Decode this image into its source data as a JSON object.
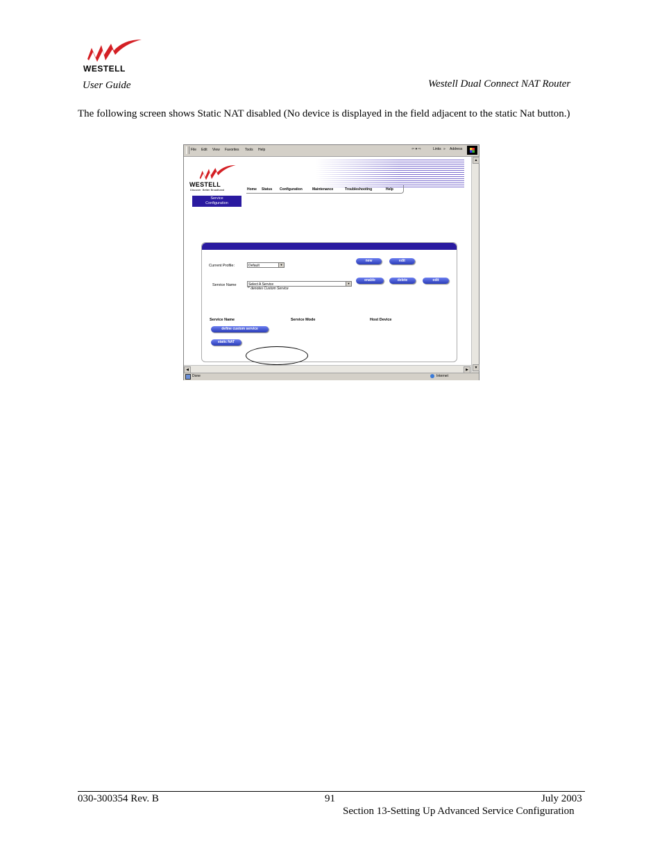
{
  "header": {
    "user_guide": "User Guide",
    "product": "Westell Dual Connect NAT Router",
    "logo_text": "WESTELL"
  },
  "intro_text": "The following screen shows Static NAT disabled (No device is displayed in the field adjacent to the static Nat button.)",
  "screenshot": {
    "menu": [
      "File",
      "Edit",
      "View",
      "Favorites",
      "Tools",
      "Help"
    ],
    "toolbar": {
      "back": "⇦ ▾ ⇨",
      "links": "Links",
      "links_more": "»",
      "address": "Address"
    },
    "logo_text": "WESTELL",
    "tagline": "Discover  Better Broadband",
    "nav": [
      "Home",
      "Status",
      "Configuration",
      "Maintenance",
      "Troubleshooting",
      "Help"
    ],
    "service_tab": [
      "Service",
      "Configuration"
    ],
    "form": {
      "current_profile_label": "Current Profile:",
      "current_profile_value": "Default",
      "service_name_label": "Service Name",
      "service_name_value": "Select A Service",
      "custom_note": "'*' denotes Custom Service",
      "buttons_row1": [
        "new",
        "edit"
      ],
      "buttons_row2": [
        "enable",
        "delete",
        "edit"
      ]
    },
    "table": {
      "columns": [
        "Service Name",
        "Service Mode",
        "Host Device"
      ],
      "define_button": "define custom service",
      "static_nat_button": "static NAT"
    },
    "status": {
      "left": "Done",
      "zone": "Internet"
    }
  },
  "footer": {
    "doc_number": "030-300354 Rev. B",
    "page_number": "91",
    "date": "July 2003",
    "section": "Section 13-Setting Up Advanced Service Configuration"
  }
}
